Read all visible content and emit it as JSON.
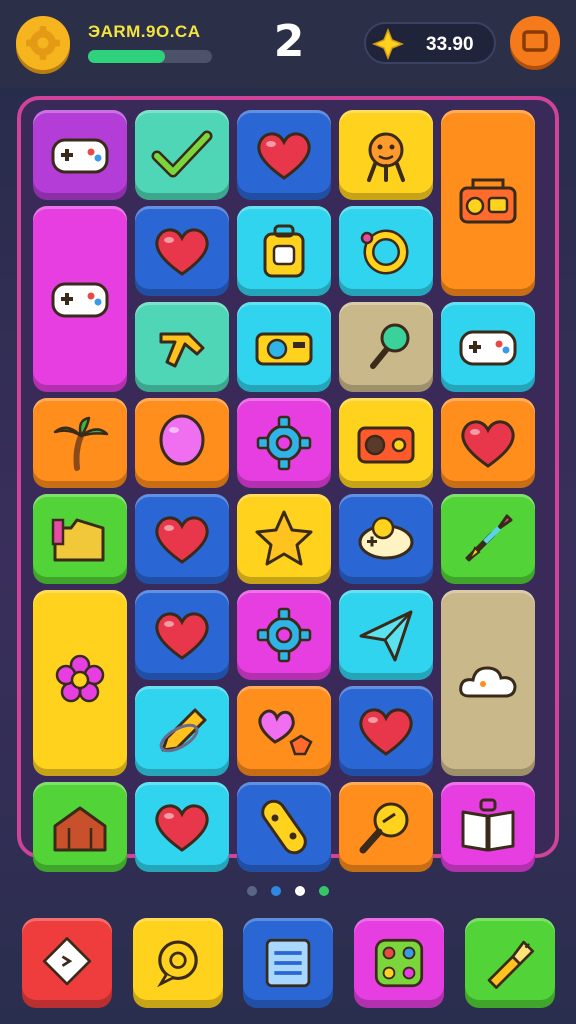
{
  "header": {
    "player_name": "ЭАRM.9O.CA",
    "level": "2",
    "coins": "33.90",
    "xp_progress": 0.62,
    "settings_icon": "gear-icon",
    "coin_icon": "sparkle-icon",
    "menu_icon": "menu-icon"
  },
  "colors": {
    "purple": "#b43dd8",
    "teal": "#4fd6b6",
    "blue": "#2a66d4",
    "yellow": "#ffd21e",
    "orange": "#ff8e1c",
    "magenta": "#e63ee0",
    "cyan": "#30d4ee",
    "tan": "#c9b98a",
    "green": "#52d438",
    "red": "#ef3d3d",
    "accent_border": "#d0439a"
  },
  "board": {
    "tiles": [
      {
        "col": 0,
        "row": 0,
        "w": 1,
        "h": 1,
        "color": "purple",
        "icon": "gamepad-icon"
      },
      {
        "col": 1,
        "row": 0,
        "w": 1,
        "h": 1,
        "color": "teal",
        "icon": "checkmark-icon"
      },
      {
        "col": 2,
        "row": 0,
        "w": 1,
        "h": 1,
        "color": "blue",
        "icon": "heart-icon"
      },
      {
        "col": 3,
        "row": 0,
        "w": 1,
        "h": 1,
        "color": "yellow",
        "icon": "character-icon"
      },
      {
        "col": 4,
        "row": 0,
        "w": 1,
        "h": 2,
        "color": "orange",
        "icon": "boombox-icon"
      },
      {
        "col": 0,
        "row": 1,
        "w": 1,
        "h": 2,
        "color": "magenta",
        "icon": "gamepad-icon"
      },
      {
        "col": 1,
        "row": 1,
        "w": 1,
        "h": 1,
        "color": "blue",
        "icon": "heart-icon"
      },
      {
        "col": 2,
        "row": 1,
        "w": 1,
        "h": 1,
        "color": "cyan",
        "icon": "backpack-icon"
      },
      {
        "col": 3,
        "row": 1,
        "w": 1,
        "h": 1,
        "color": "cyan",
        "icon": "ring-icon"
      },
      {
        "col": 1,
        "row": 2,
        "w": 1,
        "h": 1,
        "color": "teal",
        "icon": "tool-icon"
      },
      {
        "col": 2,
        "row": 2,
        "w": 1,
        "h": 1,
        "color": "cyan",
        "icon": "camera-icon"
      },
      {
        "col": 3,
        "row": 2,
        "w": 1,
        "h": 1,
        "color": "tan",
        "icon": "lollipop-icon"
      },
      {
        "col": 4,
        "row": 2,
        "w": 1,
        "h": 1,
        "color": "cyan",
        "icon": "gamepad-icon"
      },
      {
        "col": 0,
        "row": 3,
        "w": 1,
        "h": 1,
        "color": "orange",
        "icon": "palm-tree-icon"
      },
      {
        "col": 1,
        "row": 3,
        "w": 1,
        "h": 1,
        "color": "orange",
        "icon": "balloon-icon"
      },
      {
        "col": 2,
        "row": 3,
        "w": 1,
        "h": 1,
        "color": "magenta",
        "icon": "gear-icon"
      },
      {
        "col": 3,
        "row": 3,
        "w": 1,
        "h": 1,
        "color": "yellow",
        "icon": "radio-icon"
      },
      {
        "col": 4,
        "row": 3,
        "w": 1,
        "h": 1,
        "color": "orange",
        "icon": "heart-icon"
      },
      {
        "col": 0,
        "row": 4,
        "w": 1,
        "h": 1,
        "color": "green",
        "icon": "folder-icon"
      },
      {
        "col": 1,
        "row": 4,
        "w": 1,
        "h": 1,
        "color": "blue",
        "icon": "heart-icon"
      },
      {
        "col": 2,
        "row": 4,
        "w": 1,
        "h": 1,
        "color": "yellow",
        "icon": "star-icon"
      },
      {
        "col": 3,
        "row": 4,
        "w": 1,
        "h": 1,
        "color": "blue",
        "icon": "controller-icon"
      },
      {
        "col": 4,
        "row": 4,
        "w": 1,
        "h": 1,
        "color": "green",
        "icon": "rocket-icon"
      },
      {
        "col": 0,
        "row": 5,
        "w": 1,
        "h": 2,
        "color": "yellow",
        "icon": "flower-icon"
      },
      {
        "col": 1,
        "row": 5,
        "w": 1,
        "h": 1,
        "color": "blue",
        "icon": "heart-icon"
      },
      {
        "col": 2,
        "row": 5,
        "w": 1,
        "h": 1,
        "color": "magenta",
        "icon": "gear-icon"
      },
      {
        "col": 3,
        "row": 5,
        "w": 1,
        "h": 1,
        "color": "cyan",
        "icon": "paper-plane-icon"
      },
      {
        "col": 4,
        "row": 5,
        "w": 1,
        "h": 2,
        "color": "tan",
        "icon": "cloud-icon"
      },
      {
        "col": 1,
        "row": 6,
        "w": 1,
        "h": 1,
        "color": "cyan",
        "icon": "pencil-icon"
      },
      {
        "col": 2,
        "row": 6,
        "w": 1,
        "h": 1,
        "color": "orange",
        "icon": "hearts-icon"
      },
      {
        "col": 3,
        "row": 6,
        "w": 1,
        "h": 1,
        "color": "blue",
        "icon": "heart-icon"
      },
      {
        "col": 0,
        "row": 7,
        "w": 1,
        "h": 1,
        "color": "green",
        "icon": "house-icon"
      },
      {
        "col": 1,
        "row": 7,
        "w": 1,
        "h": 1,
        "color": "cyan",
        "icon": "heart-icon"
      },
      {
        "col": 2,
        "row": 7,
        "w": 1,
        "h": 1,
        "color": "blue",
        "icon": "skateboard-icon"
      },
      {
        "col": 3,
        "row": 7,
        "w": 1,
        "h": 1,
        "color": "orange",
        "icon": "magnifier-icon"
      },
      {
        "col": 4,
        "row": 7,
        "w": 1,
        "h": 1,
        "color": "magenta",
        "icon": "book-icon"
      }
    ]
  },
  "pagination": {
    "pages": 4,
    "active": 2,
    "dot_colors": [
      "#5a6483",
      "#2d8ae0",
      "#ffffff",
      "#35c66a"
    ]
  },
  "bottom_bar": [
    {
      "color": "red",
      "icon": "tag-icon"
    },
    {
      "color": "yellow",
      "icon": "chat-icon"
    },
    {
      "color": "blue",
      "icon": "list-icon"
    },
    {
      "color": "magenta",
      "icon": "palette-icon"
    },
    {
      "color": "green",
      "icon": "flashlight-icon"
    }
  ]
}
